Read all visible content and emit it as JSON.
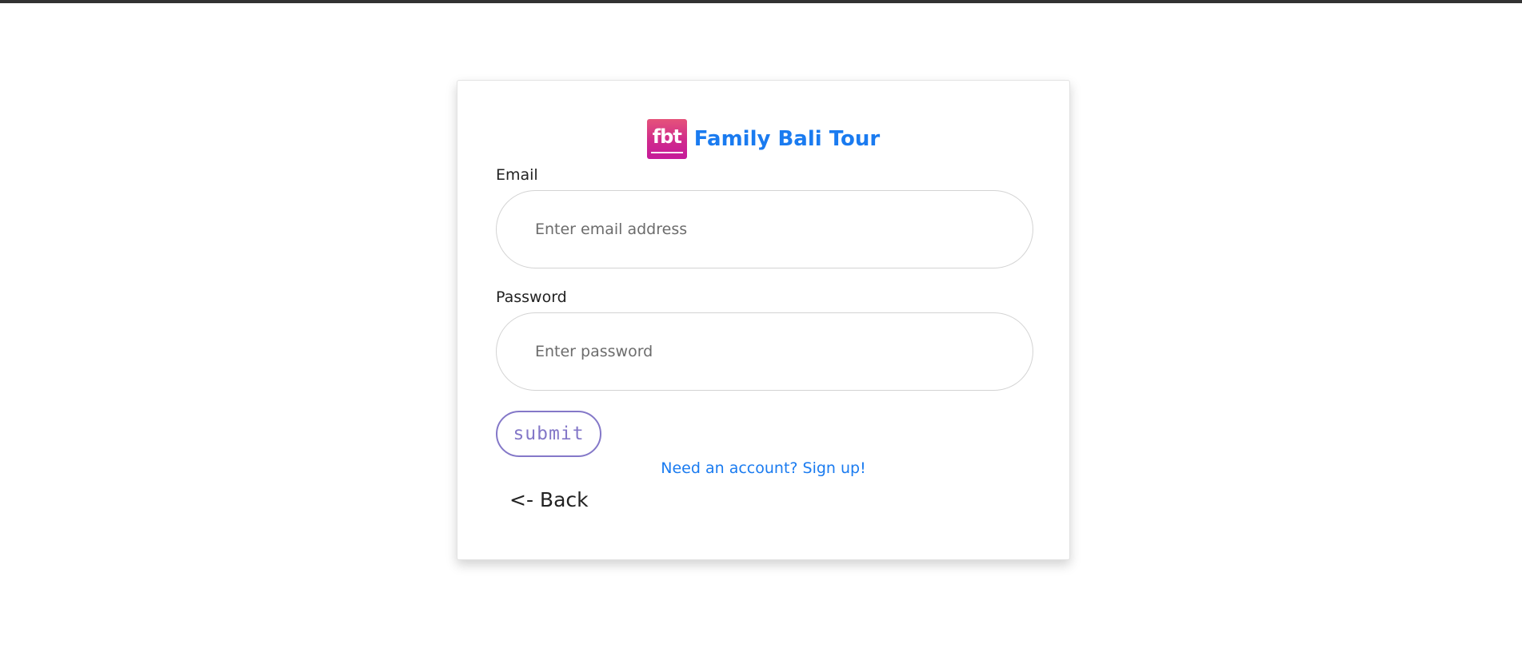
{
  "brand": {
    "logo_text": "fbt",
    "name": "Family Bali Tour",
    "logo_colors": [
      "#e5537a",
      "#c51a9a"
    ],
    "name_color": "#1a7bf0"
  },
  "form": {
    "email_label": "Email",
    "email_placeholder": "Enter email address",
    "email_value": "",
    "password_label": "Password",
    "password_placeholder": "Enter password",
    "password_value": "",
    "submit_label": "submit",
    "submit_color": "#8478c8"
  },
  "links": {
    "signup": "Need an account? Sign up!",
    "back": "<- Back",
    "link_color": "#1a7bf0"
  }
}
